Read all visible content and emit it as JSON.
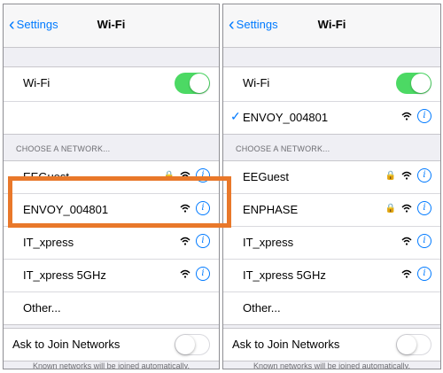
{
  "colors": {
    "accent": "#007aff",
    "toggle_on": "#4cd964",
    "highlight": "#e9782a"
  },
  "left": {
    "back_label": "Settings",
    "title": "Wi-Fi",
    "wifi_label": "Wi-Fi",
    "section_header": "CHOOSE A NETWORK...",
    "networks": [
      {
        "name": "EEGuest",
        "locked": true
      },
      {
        "name": "ENVOY_004801",
        "locked": false
      },
      {
        "name": "IT_xpress",
        "locked": false
      },
      {
        "name": "IT_xpress 5GHz",
        "locked": false
      }
    ],
    "other_label": "Other...",
    "ask_label": "Ask to Join Networks",
    "footer": "Known networks will be joined automatically."
  },
  "right": {
    "back_label": "Settings",
    "title": "Wi-Fi",
    "wifi_label": "Wi-Fi",
    "connected_network": "ENVOY_004801",
    "section_header": "CHOOSE A NETWORK...",
    "networks": [
      {
        "name": "EEGuest",
        "locked": true
      },
      {
        "name": "ENPHASE",
        "locked": true
      },
      {
        "name": "IT_xpress",
        "locked": false
      },
      {
        "name": "IT_xpress 5GHz",
        "locked": false
      }
    ],
    "other_label": "Other...",
    "ask_label": "Ask to Join Networks",
    "footer": "Known networks will be joined automatically."
  },
  "icons": {
    "wifi": "wifi-icon",
    "lock": "lock-icon",
    "info": "info-icon",
    "back": "chevron-left-icon",
    "check": "checkmark-icon"
  }
}
